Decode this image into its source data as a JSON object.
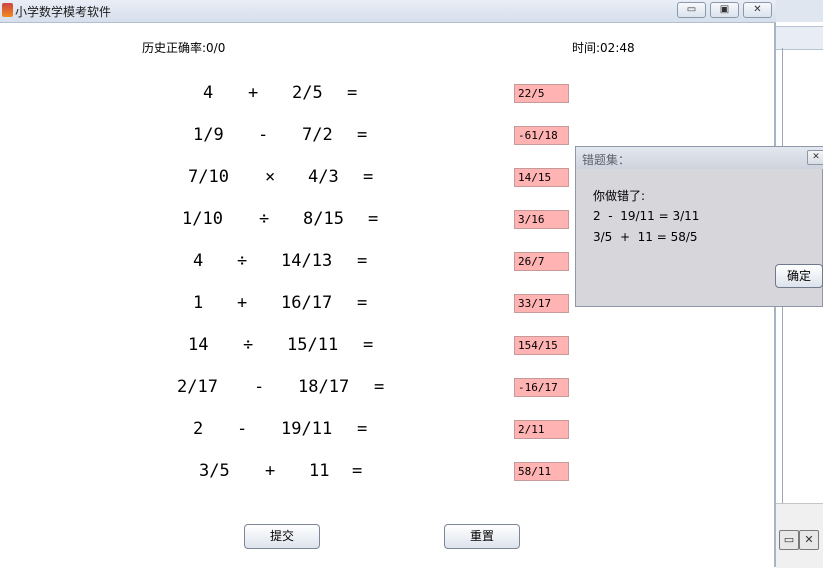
{
  "window": {
    "title": "小学数学模考软件",
    "minimize_icon": "minimize-icon",
    "maximize_icon": "maximize-icon",
    "close_icon": "close-icon"
  },
  "header": {
    "accuracy": "历史正确率:0/0",
    "timer": "时间:02:48"
  },
  "problems": [
    {
      "a": "4",
      "op": "+",
      "b": "2/5",
      "eq": "=",
      "answer": "22/5"
    },
    {
      "a": "1/9",
      "op": "-",
      "b": "7/2",
      "eq": "=",
      "answer": "-61/18"
    },
    {
      "a": "7/10",
      "op": "×",
      "b": "4/3",
      "eq": "=",
      "answer": "14/15"
    },
    {
      "a": "1/10",
      "op": "÷",
      "b": "8/15",
      "eq": "=",
      "answer": "3/16"
    },
    {
      "a": "4",
      "op": "÷",
      "b": "14/13",
      "eq": "=",
      "answer": "26/7"
    },
    {
      "a": "1",
      "op": "+",
      "b": "16/17",
      "eq": "=",
      "answer": "33/17"
    },
    {
      "a": "14",
      "op": "÷",
      "b": "15/11",
      "eq": "=",
      "answer": "154/15"
    },
    {
      "a": "2/17",
      "op": "-",
      "b": "18/17",
      "eq": "=",
      "answer": "-16/17"
    },
    {
      "a": "2",
      "op": "-",
      "b": "19/11",
      "eq": "=",
      "answer": "2/11"
    },
    {
      "a": "3/5",
      "op": "+",
      "b": "11",
      "eq": "=",
      "answer": "58/11"
    }
  ],
  "buttons": {
    "submit": "提交",
    "reset": "重置"
  },
  "dialog": {
    "title": "错题集：",
    "close_icon": "close-icon",
    "message": "你做错了:",
    "mistakes": [
      "2  -  19/11 = 3/11",
      "3/5  +  11 = 58/5"
    ],
    "ok": "确定"
  }
}
